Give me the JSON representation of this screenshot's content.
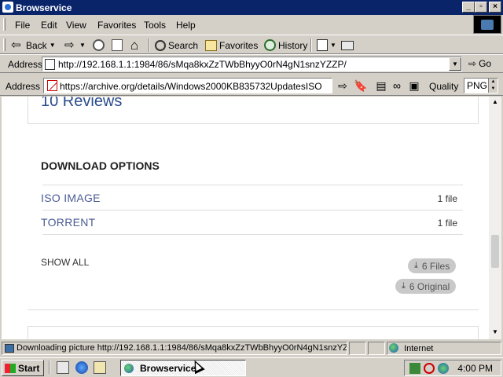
{
  "window": {
    "title": "Browservice"
  },
  "menu": {
    "items": [
      "File",
      "Edit",
      "View",
      "Favorites",
      "Tools",
      "Help"
    ]
  },
  "toolbar": {
    "back": "Back",
    "search": "Search",
    "favorites": "Favorites",
    "history": "History"
  },
  "address": {
    "label": "Address",
    "url": "http://192.168.1.1:1984/86/sMqa8kxZzTWbBhyyO0rN4gN1snzYZZP/",
    "go": "Go"
  },
  "extension_bar": {
    "address_label": "Address",
    "url": "https://archive.org/details/Windows2000KB835732UpdatesISO",
    "quality_label": "Quality",
    "quality_value": "PNG"
  },
  "page": {
    "reviews_title": "10 Reviews",
    "download_heading": "DOWNLOAD OPTIONS",
    "formats": [
      {
        "name": "ISO IMAGE",
        "count": "1 file"
      },
      {
        "name": "TORRENT",
        "count": "1 file"
      }
    ],
    "show_all": "SHOW ALL",
    "files_button": "6 Files",
    "original_button": "6 Original"
  },
  "status": {
    "text": "Downloading picture http://192.168.1.1:1984/86/sMqa8kxZzTWbBhyyO0rN4gN1snzYZ",
    "zone": "Internet"
  },
  "taskbar": {
    "start": "Start",
    "task": "Browservice",
    "clock": "4:00 PM"
  }
}
